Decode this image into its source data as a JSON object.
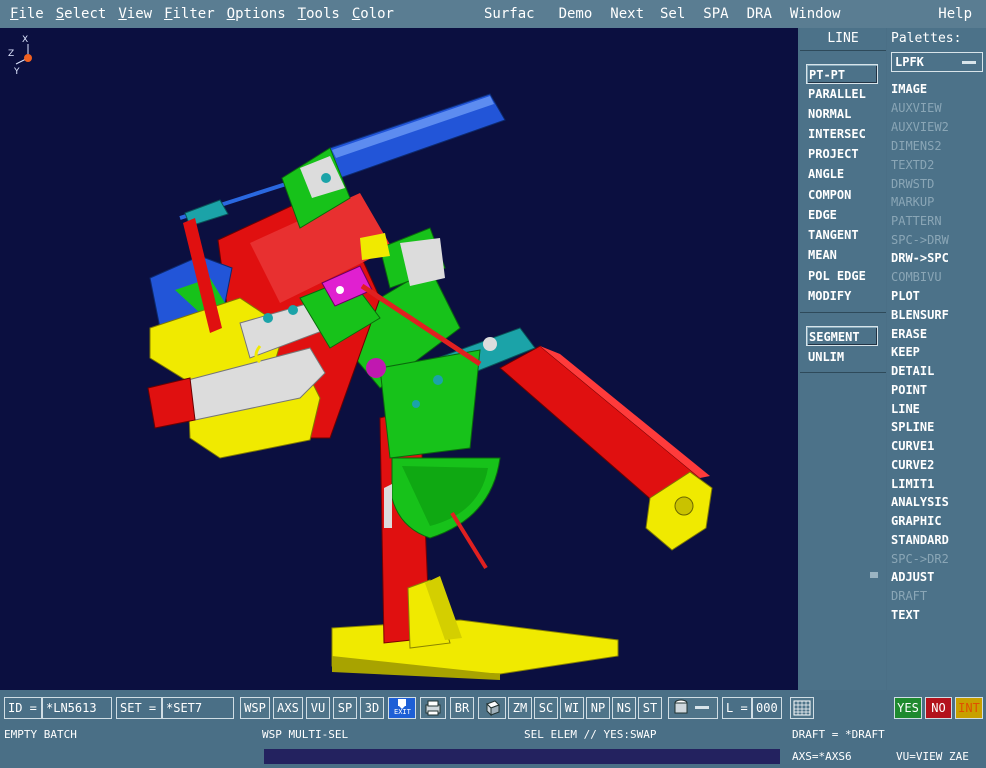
{
  "menubar": {
    "items": [
      "File",
      "Select",
      "View",
      "Filter",
      "Options",
      "Tools",
      "Color",
      "Surfac",
      "Demo",
      "Next",
      "Sel",
      "SPA",
      "DRA",
      "Window",
      "Help"
    ]
  },
  "axis": {
    "z": "Z",
    "x": "X",
    "y": "Y"
  },
  "line_panel": {
    "title": "LINE",
    "items": [
      "PT-PT",
      "PARALLEL",
      "NORMAL",
      "INTERSEC",
      "PROJECT",
      "ANGLE",
      "COMPON",
      "EDGE",
      "TANGENT",
      "MEAN",
      "POL EDGE",
      "MODIFY"
    ],
    "mode_items": [
      "SEGMENT",
      "UNLIM"
    ],
    "selected": "PT-PT",
    "selected_mode": "SEGMENT"
  },
  "palettes": {
    "title": "Palettes:",
    "current": "LPFK",
    "items": [
      {
        "label": "IMAGE",
        "enabled": true
      },
      {
        "label": "AUXVIEW",
        "enabled": false
      },
      {
        "label": "AUXVIEW2",
        "enabled": false
      },
      {
        "label": "DIMENS2",
        "enabled": false
      },
      {
        "label": "TEXTD2",
        "enabled": false
      },
      {
        "label": "DRWSTD",
        "enabled": false
      },
      {
        "label": "MARKUP",
        "enabled": false
      },
      {
        "label": "PATTERN",
        "enabled": false
      },
      {
        "label": "SPC->DRW",
        "enabled": false
      },
      {
        "label": "DRW->SPC",
        "enabled": true
      },
      {
        "label": "COMBIVU",
        "enabled": false
      },
      {
        "label": "PLOT",
        "enabled": true
      },
      {
        "label": "BLENSURF",
        "enabled": true
      },
      {
        "label": "ERASE",
        "enabled": true
      },
      {
        "label": "KEEP",
        "enabled": true
      },
      {
        "label": "DETAIL",
        "enabled": true
      },
      {
        "label": "POINT",
        "enabled": true
      },
      {
        "label": "LINE",
        "enabled": true
      },
      {
        "label": "SPLINE",
        "enabled": true
      },
      {
        "label": "CURVE1",
        "enabled": true
      },
      {
        "label": "CURVE2",
        "enabled": true
      },
      {
        "label": "LIMIT1",
        "enabled": true
      },
      {
        "label": "ANALYSIS",
        "enabled": true
      },
      {
        "label": "GRAPHIC",
        "enabled": true
      },
      {
        "label": "STANDARD",
        "enabled": true
      },
      {
        "label": "SPC->DR2",
        "enabled": false
      },
      {
        "label": "ADJUST",
        "enabled": true
      },
      {
        "label": "DRAFT",
        "enabled": false
      },
      {
        "label": "TEXT",
        "enabled": true
      }
    ]
  },
  "toolbar": {
    "id_label": "ID =",
    "id_value": "*LN5613",
    "set_label": "SET =",
    "set_value": "*SET7",
    "buttons": [
      "WSP",
      "AXS",
      "VU",
      "SP",
      "3D"
    ],
    "exit_label": "EXIT",
    "buttons2": [
      "BR"
    ],
    "buttons3": [
      "ZM",
      "SC",
      "WI",
      "NP",
      "NS",
      "ST"
    ],
    "l_label": "L =",
    "l_value": "000",
    "yes": "YES",
    "no": "NO",
    "int": "INT",
    "colors": {
      "yes": "#1f8a2f",
      "no": "#b3121c",
      "int": "#c8a000"
    }
  },
  "status": {
    "left": "EMPTY BATCH",
    "wsp": "WSP MULTI-SEL",
    "sel": "SEL ELEM // YES:SWAP",
    "draft": "DRAFT = *DRAFT",
    "axs": "AXS=*AXS6",
    "vu": "VU=VIEW ZAE"
  }
}
